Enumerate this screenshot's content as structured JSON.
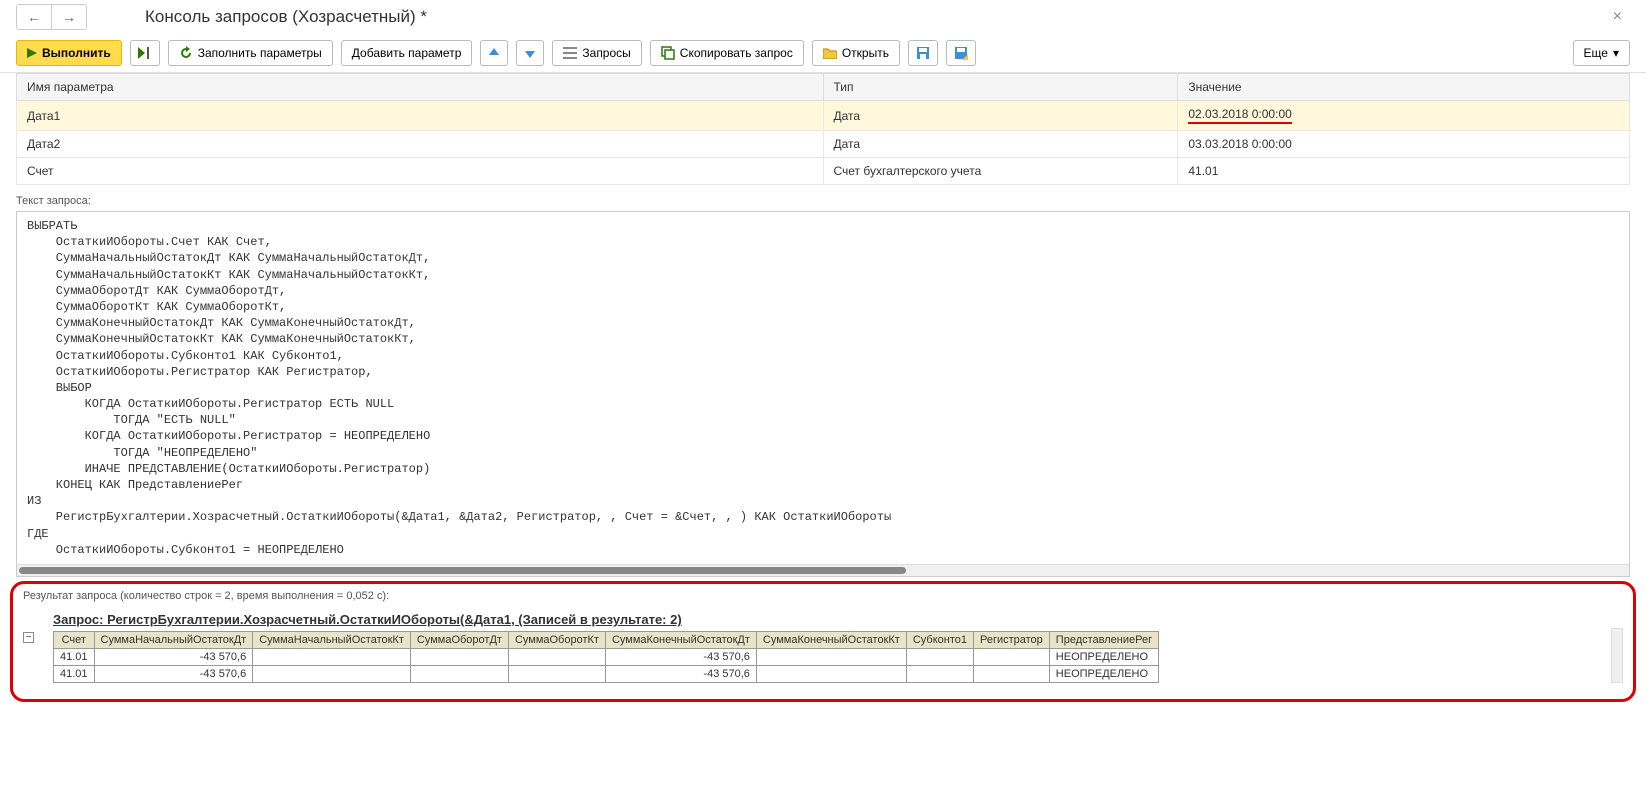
{
  "header": {
    "title": "Консоль запросов (Хозрасчетный) *"
  },
  "toolbar": {
    "execute": "Выполнить",
    "fill_params": "Заполнить параметры",
    "add_param": "Добавить параметр",
    "queries": "Запросы",
    "copy_query": "Скопировать запрос",
    "open": "Открыть",
    "more": "Еще"
  },
  "params": {
    "col_name": "Имя параметра",
    "col_type": "Тип",
    "col_value": "Значение",
    "rows": [
      {
        "name": "Дата1",
        "type": "Дата",
        "value": "02.03.2018 0:00:00",
        "highlighted": true,
        "underlined": true
      },
      {
        "name": "Дата2",
        "type": "Дата",
        "value": "03.03.2018 0:00:00",
        "highlighted": false,
        "underlined": false
      },
      {
        "name": "Счет",
        "type": "Счет бухгалтерского учета",
        "value": "41.01",
        "highlighted": false,
        "underlined": false
      }
    ]
  },
  "query": {
    "label": "Текст запроса:",
    "text": "ВЫБРАТЬ\n    ОстаткиИОбороты.Счет КАК Счет,\n    СуммаНачальныйОстатокДт КАК СуммаНачальныйОстатокДт,\n    СуммаНачальныйОстатокКт КАК СуммаНачальныйОстатокКт,\n    СуммаОборотДт КАК СуммаОборотДт,\n    СуммаОборотКт КАК СуммаОборотКт,\n    СуммаКонечныйОстатокДт КАК СуммаКонечныйОстатокДт,\n    СуммаКонечныйОстатокКт КАК СуммаКонечныйОстатокКт,\n    ОстаткиИОбороты.Субконто1 КАК Субконто1,\n    ОстаткиИОбороты.Регистратор КАК Регистратор,\n    ВЫБОР\n        КОГДА ОстаткиИОбороты.Регистратор ЕСТЬ NULL\n            ТОГДА \"ЕСТЬ NULL\"\n        КОГДА ОстаткиИОбороты.Регистратор = НЕОПРЕДЕЛЕНО\n            ТОГДА \"НЕОПРЕДЕЛЕНО\"\n        ИНАЧЕ ПРЕДСТАВЛЕНИЕ(ОстаткиИОбороты.Регистратор)\n    КОНЕЦ КАК ПредставлениеРег\nИЗ\n    РегистрБухгалтерии.Хозрасчетный.ОстаткиИОбороты(&Дата1, &Дата2, Регистратор, , Счет = &Счет, , ) КАК ОстаткиИОбороты\nГДЕ\n    ОстаткиИОбороты.Субконто1 = НЕОПРЕДЕЛЕНО"
  },
  "result": {
    "label": "Результат запроса (количество строк = 2, время выполнения = 0,052 с):",
    "title": "Запрос: РегистрБухгалтерии.Хозрасчетный.ОстаткиИОбороты(&Дата1, (Записей в результате: 2)",
    "columns": [
      "Счет",
      "СуммаНачальныйОстатокДт",
      "СуммаНачальныйОстатокКт",
      "СуммаОборотДт",
      "СуммаОборотКт",
      "СуммаКонечныйОстатокДт",
      "СуммаКонечныйОстатокКт",
      "Субконто1",
      "Регистратор",
      "ПредставлениеРег"
    ],
    "rows": [
      {
        "acct": "41.01",
        "c1": "-43 570,6",
        "c2": "",
        "c3": "",
        "c4": "",
        "c5": "-43 570,6",
        "c6": "",
        "c7": "",
        "c8": "",
        "c9": "НЕОПРЕДЕЛЕНО"
      },
      {
        "acct": "41.01",
        "c1": "-43 570,6",
        "c2": "",
        "c3": "",
        "c4": "",
        "c5": "-43 570,6",
        "c6": "",
        "c7": "",
        "c8": "",
        "c9": "НЕОПРЕДЕЛЕНО"
      }
    ]
  }
}
